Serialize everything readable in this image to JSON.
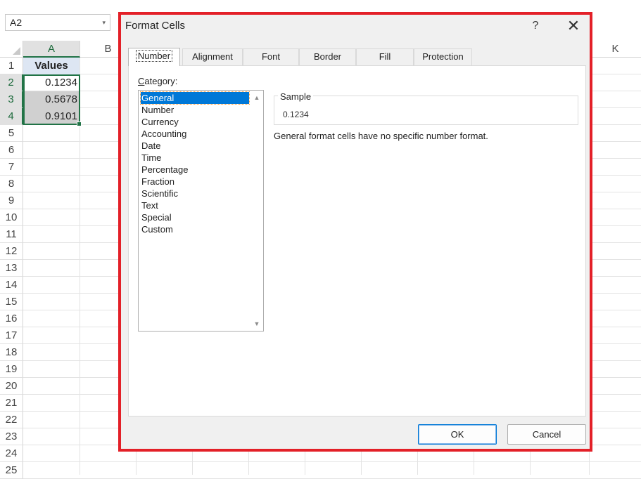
{
  "namebox": {
    "value": "A2",
    "caret": "▾"
  },
  "sheet": {
    "columns": [
      "A",
      "B",
      "K"
    ],
    "rows": [
      "1",
      "2",
      "3",
      "4",
      "5",
      "6",
      "7",
      "8",
      "9",
      "10",
      "11",
      "12",
      "13",
      "14",
      "15",
      "16",
      "17",
      "18",
      "19",
      "20",
      "21",
      "22",
      "23",
      "24",
      "25"
    ],
    "cells": {
      "header": "Values",
      "values": [
        "0.1234",
        "0.5678",
        "0.9101"
      ]
    }
  },
  "dialog": {
    "title": "Format Cells",
    "help": "?",
    "close": "✕",
    "tabs": [
      "Number",
      "Alignment",
      "Font",
      "Border",
      "Fill",
      "Protection"
    ],
    "active_tab": "Number",
    "category_label_underlined": "C",
    "category_label_rest": "ategory:",
    "categories": [
      "General",
      "Number",
      "Currency",
      "Accounting",
      "Date",
      "Time",
      "Percentage",
      "Fraction",
      "Scientific",
      "Text",
      "Special",
      "Custom"
    ],
    "selected_category": "General",
    "scroll_up": "▲",
    "scroll_down": "▼",
    "sample_label": "Sample",
    "sample_value": "0.1234",
    "description": "General format cells have no specific number format.",
    "ok_label": "OK",
    "cancel_label": "Cancel"
  },
  "colors": {
    "accent": "#217346",
    "highlight_border": "#e32028",
    "selection": "#0078d7",
    "header_fill": "#dde6f3"
  }
}
